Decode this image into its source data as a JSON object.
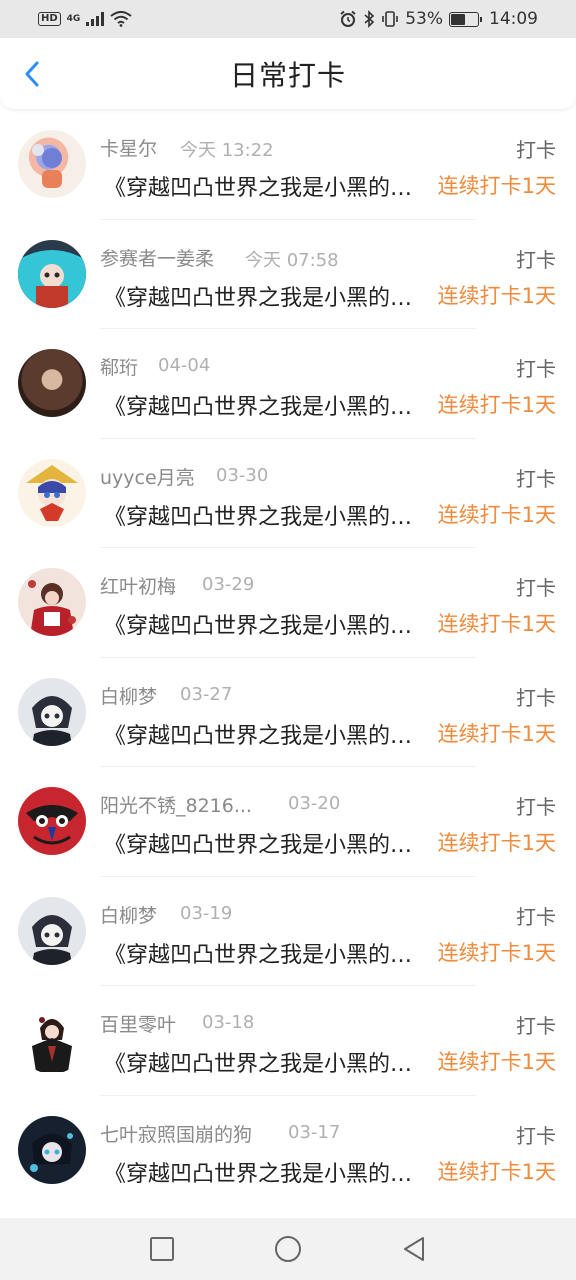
{
  "status_bar": {
    "hd": "HD",
    "network": "4G",
    "battery_percent": "53%",
    "battery_level": 0.53,
    "time": "14:09"
  },
  "header": {
    "title": "日常打卡",
    "back_icon": "chevron-left-icon",
    "accent_color": "#2a8ff7"
  },
  "items": [
    {
      "name": "卡星尔",
      "time": "今天 13:22",
      "tag": "打卡",
      "title": "《穿越凹凸世界之我是小黑的妹妹》",
      "streak": "连续打卡1天"
    },
    {
      "name": "参赛者一姜柔",
      "time": "今天 07:58",
      "tag": "打卡",
      "title": "《穿越凹凸世界之我是小黑的妹妹》",
      "streak": "连续打卡1天"
    },
    {
      "name": "郗珩",
      "time": "04-04",
      "tag": "打卡",
      "title": "《穿越凹凸世界之我是小黑的妹妹》",
      "streak": "连续打卡1天"
    },
    {
      "name": "uyyce月亮",
      "time": "03-30",
      "tag": "打卡",
      "title": "《穿越凹凸世界之我是小黑的妹妹》",
      "streak": "连续打卡1天"
    },
    {
      "name": "红叶初梅",
      "time": "03-29",
      "tag": "打卡",
      "title": "《穿越凹凸世界之我是小黑的妹妹》",
      "streak": "连续打卡1天"
    },
    {
      "name": "白柳梦",
      "time": "03-27",
      "tag": "打卡",
      "title": "《穿越凹凸世界之我是小黑的妹妹》",
      "streak": "连续打卡1天"
    },
    {
      "name": "阳光不锈_8216...",
      "time": "03-20",
      "tag": "打卡",
      "title": "《穿越凹凸世界之我是小黑的妹妹》",
      "streak": "连续打卡1天"
    },
    {
      "name": "白柳梦",
      "time": "03-19",
      "tag": "打卡",
      "title": "《穿越凹凸世界之我是小黑的妹妹》",
      "streak": "连续打卡1天"
    },
    {
      "name": "百里零叶",
      "time": "03-18",
      "tag": "打卡",
      "title": "《穿越凹凸世界之我是小黑的妹妹》",
      "streak": "连续打卡1天"
    },
    {
      "name": "七叶寂照国崩的狗",
      "time": "03-17",
      "tag": "打卡",
      "title": "《穿越凹凸世界之我是小黑的妹妹》",
      "streak": "连续打卡1天"
    }
  ],
  "colors": {
    "streak": "#f08a3c",
    "name": "#8a8a8a",
    "time": "#b0b0b0"
  },
  "nav_bar": {
    "icons": [
      "square-recents-icon",
      "circle-home-icon",
      "triangle-back-icon"
    ]
  }
}
